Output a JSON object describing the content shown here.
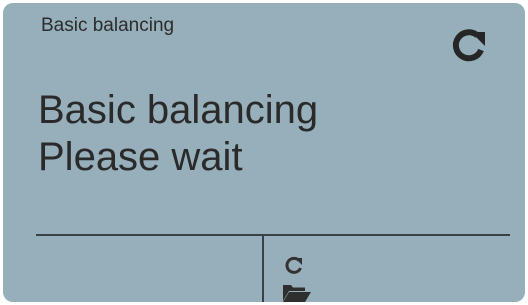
{
  "header": {
    "title": "Basic balancing",
    "refresh_icon": "refresh-icon"
  },
  "main": {
    "line1": "Basic balancing",
    "line2": "Please wait"
  },
  "footer": {
    "icons": [
      "refresh-icon",
      "folder-open-icon"
    ]
  },
  "colors": {
    "background": "#97afba",
    "text": "#2a2a2a",
    "divider": "#3a4146"
  }
}
